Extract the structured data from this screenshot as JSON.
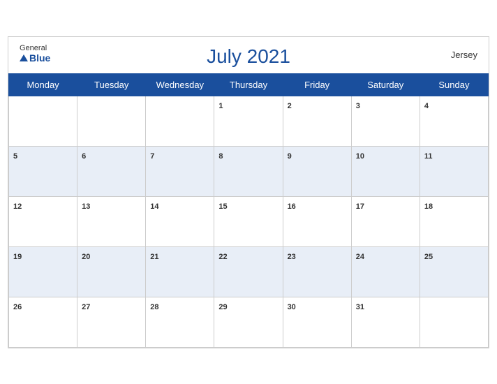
{
  "header": {
    "logo_general": "General",
    "logo_blue": "Blue",
    "title": "July 2021",
    "region": "Jersey"
  },
  "weekdays": [
    "Monday",
    "Tuesday",
    "Wednesday",
    "Thursday",
    "Friday",
    "Saturday",
    "Sunday"
  ],
  "weeks": [
    [
      null,
      null,
      null,
      1,
      2,
      3,
      4
    ],
    [
      5,
      6,
      7,
      8,
      9,
      10,
      11
    ],
    [
      12,
      13,
      14,
      15,
      16,
      17,
      18
    ],
    [
      19,
      20,
      21,
      22,
      23,
      24,
      25
    ],
    [
      26,
      27,
      28,
      29,
      30,
      31,
      null
    ]
  ]
}
